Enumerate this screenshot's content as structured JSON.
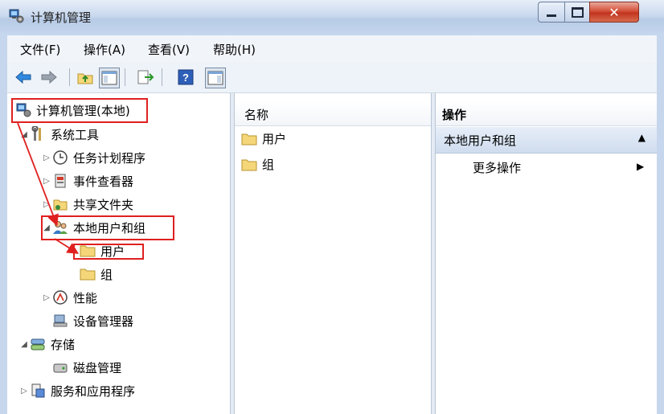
{
  "window": {
    "title": "计算机管理",
    "close_glyph": "✕"
  },
  "menu": [
    "文件(F)",
    "操作(A)",
    "查看(V)",
    "帮助(H)"
  ],
  "toolbar": {
    "buttons": [
      "back-icon",
      "forward-icon",
      "up-folder-icon",
      "show-hide-tree-icon",
      "export-icon",
      "help-icon",
      "show-action-pane-icon"
    ]
  },
  "tree": {
    "root": "计算机管理(本地)",
    "system_tools": "系统工具",
    "task_scheduler": "任务计划程序",
    "event_viewer": "事件查看器",
    "shared_folders": "共享文件夹",
    "local_users_groups": "本地用户和组",
    "users": "用户",
    "groups": "组",
    "performance": "性能",
    "device_manager": "设备管理器",
    "storage": "存储",
    "disk_management": "磁盘管理",
    "services_apps": "服务和应用程序"
  },
  "list": {
    "column_name": "名称",
    "items": [
      "用户",
      "组"
    ]
  },
  "actions": {
    "header": "操作",
    "group": "本地用户和组",
    "more_actions": "更多操作"
  },
  "colors": {
    "highlight": "#e02020",
    "folder": "#f5d77a",
    "frame": "#c6d6ec"
  }
}
